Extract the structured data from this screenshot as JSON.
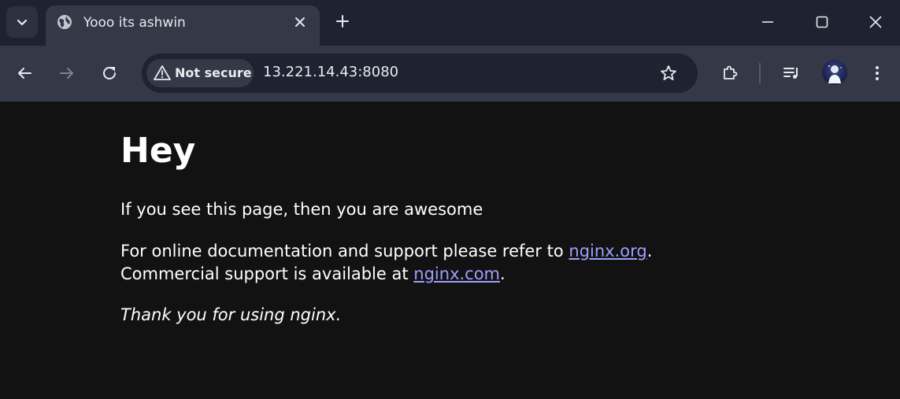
{
  "browser": {
    "tab": {
      "title": "Yooo its ashwin"
    },
    "security_label": "Not secure",
    "url": "13.221.14.43:8080"
  },
  "page": {
    "heading": "Hey",
    "para1": "If you see this page, then you are awesome",
    "para2_prefix": "For online documentation and support please refer to ",
    "link_org": "nginx.org",
    "para2_mid": ".",
    "para2_line2_prefix": "Commercial support is available at ",
    "link_com": "nginx.com",
    "para2_suffix": ".",
    "thanks": "Thank you for using nginx."
  },
  "colors": {
    "page_bg": "#121212",
    "link": "#9e9eff",
    "toolbar_bg": "#343847",
    "tabstrip_bg": "#1f2331"
  },
  "icons": [
    "tab-search-icon",
    "globe-icon",
    "close-icon",
    "plus-icon",
    "minimize-icon",
    "maximize-icon",
    "window-close-icon",
    "back-arrow-icon",
    "forward-arrow-icon",
    "reload-icon",
    "warning-icon",
    "star-icon",
    "extensions-icon",
    "media-controls-icon",
    "more-menu-icon"
  ]
}
